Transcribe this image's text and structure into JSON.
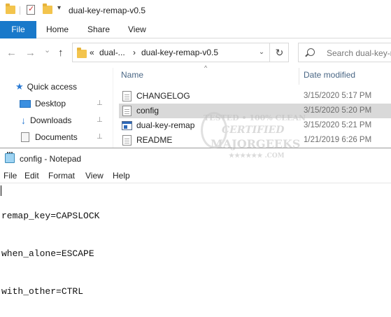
{
  "explorer": {
    "window_title": "dual-key-remap-v0.5",
    "qat": {
      "folder_icon": "folder-icon",
      "properties_icon": "properties-icon",
      "dropdown_glyph": "▾"
    },
    "ribbon": {
      "tabs": [
        "File",
        "Home",
        "Share",
        "View"
      ],
      "file_tab_color": "#1979ca"
    },
    "address": {
      "back": "←",
      "forward": "→",
      "recent": "⌄",
      "up": "↑",
      "chevron_overflow": "«",
      "crumbs": [
        "dual-...",
        "dual-key-remap-v0.5"
      ],
      "separator": "›",
      "dropdown": "⌄",
      "refresh": "↻"
    },
    "search": {
      "placeholder": "Search dual-key-r"
    },
    "nav_pane": {
      "items": [
        {
          "label": "Quick access",
          "icon": "star-icon"
        },
        {
          "label": "Desktop",
          "icon": "desktop-icon",
          "pinned": true
        },
        {
          "label": "Downloads",
          "icon": "download-icon",
          "pinned": true
        },
        {
          "label": "Documents",
          "icon": "documents-icon",
          "pinned": true
        }
      ],
      "pin_glyph": "📌"
    },
    "columns": {
      "name": "Name",
      "date_modified": "Date modified",
      "sort_glyph": "^"
    },
    "files": [
      {
        "name": "CHANGELOG",
        "date": "3/15/2020 5:17 PM",
        "icon": "text-file-icon",
        "selected": false
      },
      {
        "name": "config",
        "date": "3/15/2020 5:20 PM",
        "icon": "text-file-icon",
        "selected": true
      },
      {
        "name": "dual-key-remap",
        "date": "3/15/2020 5:21 PM",
        "icon": "executable-icon",
        "selected": false
      },
      {
        "name": "README",
        "date": "1/21/2019 6:26 PM",
        "icon": "text-file-icon",
        "selected": false
      }
    ],
    "selection_color": "#d9d9d9",
    "watermark": {
      "line1": "TESTED • 100% CLEAN",
      "line2": "CERTIFIED",
      "line3": "MAJORGEEKS",
      "line4": "★★★★★★ .COM"
    }
  },
  "notepad": {
    "window_title": "config - Notepad",
    "menu": [
      "File",
      "Edit",
      "Format",
      "View",
      "Help"
    ],
    "lines": [
      "remap_key=CAPSLOCK",
      "when_alone=ESCAPE",
      "with_other=CTRL"
    ]
  }
}
